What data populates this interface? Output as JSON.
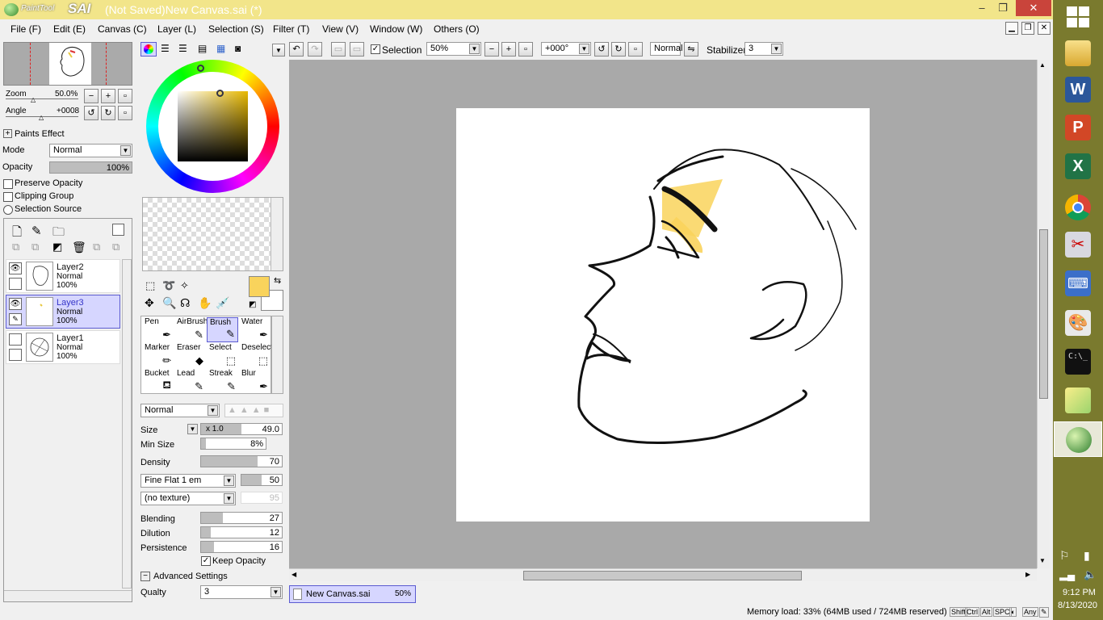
{
  "app": {
    "title": "(Not Saved)New Canvas.sai (*)",
    "logo_text_paint": "PaintTool",
    "logo_text_sai": "SAI",
    "window_controls": [
      "–",
      "❐",
      "✕"
    ]
  },
  "menu": [
    {
      "label": "File (F)"
    },
    {
      "label": "Edit (E)"
    },
    {
      "label": "Canvas (C)"
    },
    {
      "label": "Layer (L)"
    },
    {
      "label": "Selection (S)"
    },
    {
      "label": "Filter (T)"
    },
    {
      "label": "View (V)"
    },
    {
      "label": "Window (W)"
    },
    {
      "label": "Others (O)"
    }
  ],
  "navigator": {
    "zoom_label": "Zoom",
    "zoom_value": "50.0%",
    "angle_label": "Angle",
    "angle_value": "+0008"
  },
  "paints_effect": {
    "header": "Paints Effect",
    "mode_label": "Mode",
    "mode_value": "Normal",
    "opacity_label": "Opacity",
    "opacity_value": "100%",
    "preserve_opacity": "Preserve Opacity",
    "clipping_group": "Clipping Group",
    "selection_source": "Selection Source"
  },
  "layers": [
    {
      "name": "Layer2",
      "blend": "Normal",
      "opacity": "100%",
      "visible": true,
      "active": false
    },
    {
      "name": "Layer3",
      "blend": "Normal",
      "opacity": "100%",
      "visible": true,
      "active": true
    },
    {
      "name": "Layer1",
      "blend": "Normal",
      "opacity": "100%",
      "visible": false,
      "active": false
    }
  ],
  "colors": {
    "primary": "#f9d35c",
    "secondary": "#ffffff",
    "accent_selection": "#d6d6ff"
  },
  "tools": [
    {
      "label": "Pen",
      "glyph": "✒"
    },
    {
      "label": "AirBrush",
      "glyph": "✈"
    },
    {
      "label": "Brush",
      "glyph": "🖌"
    },
    {
      "label": "Water",
      "glyph": "💧"
    },
    {
      "label": "Marker",
      "glyph": "✏"
    },
    {
      "label": "Eraser",
      "glyph": "◆"
    },
    {
      "label": "Select",
      "glyph": "⬚"
    },
    {
      "label": "Deselect",
      "glyph": "⬚"
    },
    {
      "label": "Bucket",
      "glyph": "🪣"
    },
    {
      "label": "Lead",
      "glyph": "✎"
    },
    {
      "label": "Streak",
      "glyph": "✎"
    },
    {
      "label": "Blur",
      "glyph": "✒"
    }
  ],
  "brush": {
    "mode": "Normal",
    "size_label": "Size",
    "size_mult": "x 1.0",
    "size_value": "49.0",
    "min_size_label": "Min Size",
    "min_size_value": "8%",
    "density_label": "Density",
    "density_value": "70",
    "shape": "Fine Flat 1 em",
    "shape_value": "50",
    "texture": "(no texture)",
    "texture_value": "95",
    "blending_label": "Blending",
    "blending_value": "27",
    "dilution_label": "Dilution",
    "dilution_value": "12",
    "persistence_label": "Persistence",
    "persistence_value": "16",
    "keep_opacity": "Keep Opacity",
    "advanced": "Advanced Settings",
    "quality_label": "Qualty",
    "quality_value": "3"
  },
  "toolbar": {
    "selection_label": "Selection",
    "zoom_value": "50%",
    "angle_value": "+000°",
    "blend_value": "Normal",
    "stabilizer_label": "Stabilizer",
    "stabilizer_value": "3"
  },
  "document_tab": {
    "name": "New Canvas.sai",
    "zoom": "50%"
  },
  "status": {
    "memory": "Memory load: 33% (64MB used / 724MB reserved)",
    "keys": [
      "Shift",
      "Ctrl",
      "Alt",
      "SPC",
      "◐",
      "Any",
      "✎"
    ]
  },
  "taskbar": {
    "time": "9:12 PM",
    "date": "8/13/2020",
    "apps": [
      "file-explorer",
      "word",
      "powerpoint",
      "excel",
      "chrome",
      "snipping-tool",
      "on-screen-keyboard",
      "paint",
      "command-prompt",
      "sticky-notes",
      "painttool-sai"
    ]
  }
}
